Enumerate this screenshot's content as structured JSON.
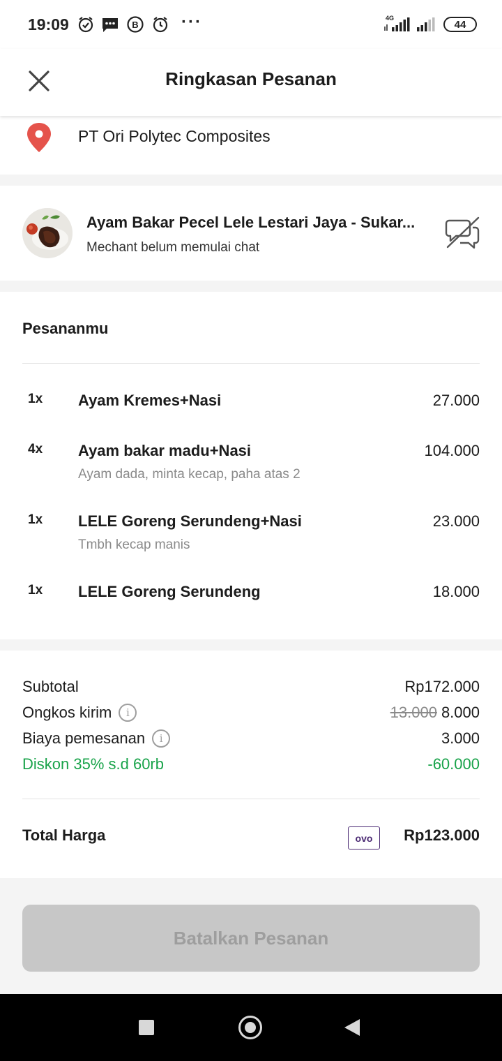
{
  "status_bar": {
    "time": "19:09",
    "battery": "44",
    "network": "4G",
    "more": "···"
  },
  "header": {
    "title": "Ringkasan Pesanan",
    "close_icon": "close-icon"
  },
  "location": {
    "icon": "location-pin-icon",
    "name": "PT Ori Polytec Composites"
  },
  "merchant": {
    "name": "Ayam Bakar Pecel Lele Lestari Jaya - Sukar...",
    "status": "Mechant belum memulai chat",
    "chat_icon": "chat-disabled-icon"
  },
  "order": {
    "title": "Pesananmu",
    "items": [
      {
        "qty": "1x",
        "name": "Ayam Kremes+Nasi",
        "note": "",
        "price": "27.000"
      },
      {
        "qty": "4x",
        "name": "Ayam bakar madu+Nasi",
        "note": "Ayam dada, minta kecap, paha atas 2",
        "price": "104.000"
      },
      {
        "qty": "1x",
        "name": "LELE Goreng Serundeng+Nasi",
        "note": "Tmbh kecap manis",
        "price": "23.000"
      },
      {
        "qty": "1x",
        "name": "LELE Goreng Serundeng",
        "note": "",
        "price": "18.000"
      }
    ]
  },
  "summary": {
    "subtotal_label": "Subtotal",
    "subtotal_value": "Rp172.000",
    "delivery_label": "Ongkos kirim",
    "delivery_original": "13.000",
    "delivery_value": "8.000",
    "order_fee_label": "Biaya pemesanan",
    "order_fee_value": "3.000",
    "discount_label": "Diskon 35% s.d 60rb",
    "discount_value": "-60.000",
    "total_label": "Total Harga",
    "payment_method": "ovo",
    "total_value": "Rp123.000",
    "info_glyph": "i"
  },
  "actions": {
    "cancel_label": "Batalkan Pesanan"
  },
  "colors": {
    "accent_green": "#19a34a",
    "pin_red": "#e5534b",
    "ovo_purple": "#4b2a73",
    "disabled_button": "#c7c7c7"
  }
}
